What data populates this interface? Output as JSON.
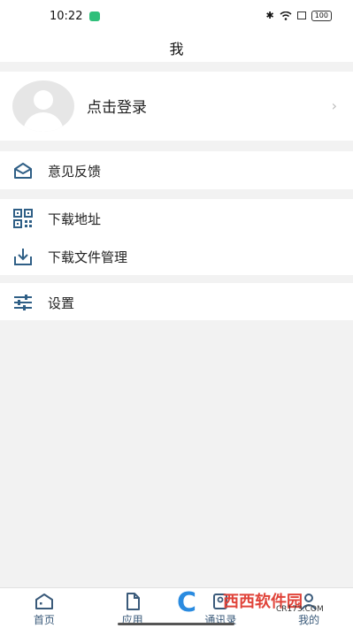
{
  "status_bar": {
    "time": "10:22",
    "battery": "100"
  },
  "header": {
    "title": "我"
  },
  "login": {
    "label": "点击登录",
    "chevron": "›"
  },
  "menu": {
    "feedback": {
      "label": "意见反馈",
      "icon": "mail-open-icon"
    },
    "download_address": {
      "label": "下载地址",
      "icon": "qr-code-icon"
    },
    "download_manager": {
      "label": "下载文件管理",
      "icon": "download-tray-icon"
    },
    "settings": {
      "label": "设置",
      "icon": "sliders-icon"
    }
  },
  "tabs": [
    {
      "label": "首页",
      "icon": "home-icon"
    },
    {
      "label": "应用",
      "icon": "file-icon"
    },
    {
      "label": "通讯录",
      "icon": "contacts-icon"
    },
    {
      "label": "我的",
      "icon": "user-icon"
    }
  ],
  "watermark": {
    "brand": "西西软件园",
    "url": "CR173.COM"
  },
  "colors": {
    "accent": "#2f5f86",
    "background": "#f2f2f2",
    "card": "#ffffff"
  }
}
